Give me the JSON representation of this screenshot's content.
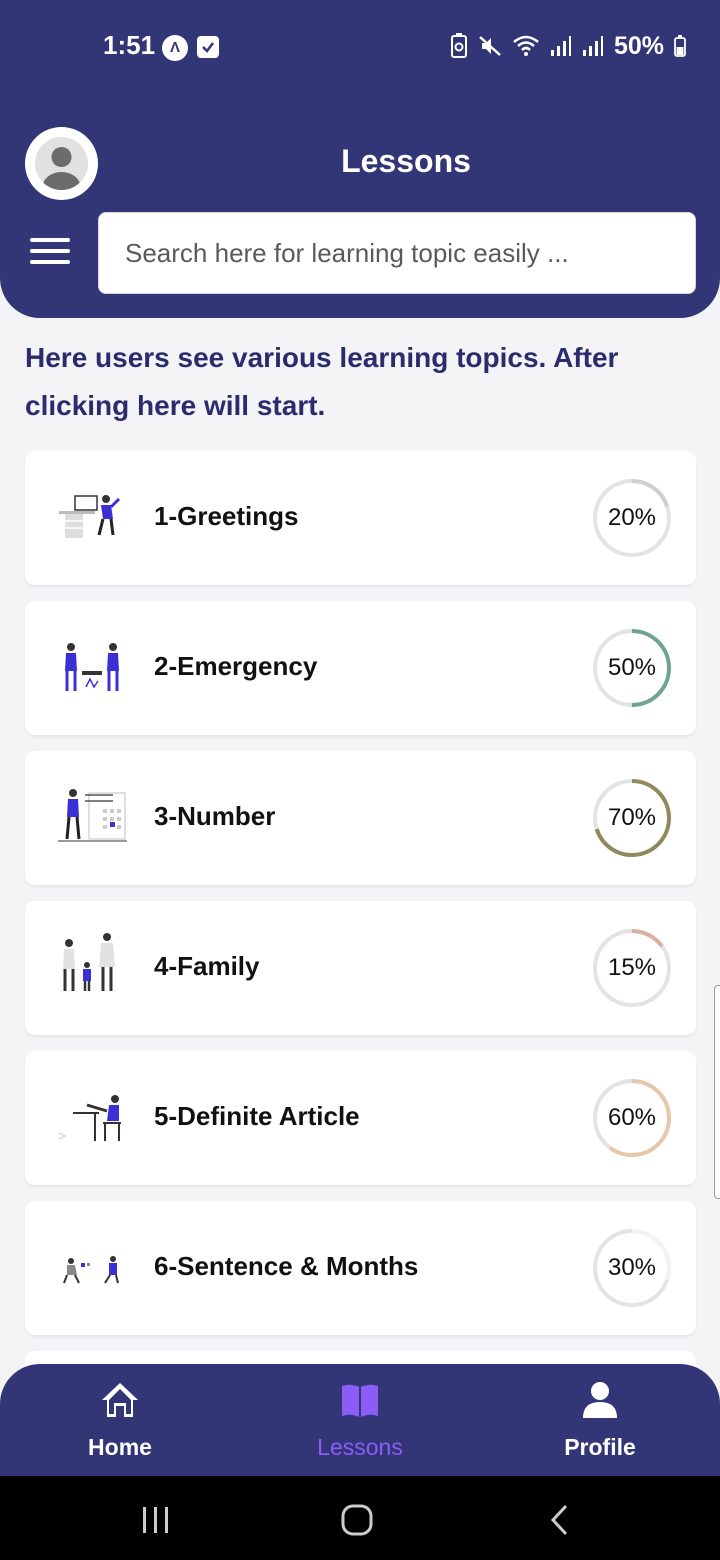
{
  "status_bar": {
    "time": "1:51",
    "battery": "50%"
  },
  "header": {
    "title": "Lessons",
    "search": {
      "placeholder": "Search here for learning topic easily ...",
      "value": ""
    }
  },
  "intro_text": "Here users see various learning topics. After clicking here will start.",
  "lessons": [
    {
      "title": "1-Greetings",
      "progress": "20%",
      "progress_value": 20,
      "color": "#cfcfcf"
    },
    {
      "title": "2-Emergency",
      "progress": "50%",
      "progress_value": 50,
      "color": "#6fa58e"
    },
    {
      "title": "3-Number",
      "progress": "70%",
      "progress_value": 70,
      "color": "#8e8a5c"
    },
    {
      "title": "4-Family",
      "progress": "15%",
      "progress_value": 15,
      "color": "#d9b29e"
    },
    {
      "title": "5-Definite Article",
      "progress": "60%",
      "progress_value": 60,
      "color": "#e6c7a9"
    },
    {
      "title": "6-Sentence & Months",
      "progress": "30%",
      "progress_value": 30,
      "color": "#f3f3f6"
    }
  ],
  "bottom_nav": {
    "items": [
      {
        "label": "Home",
        "icon": "home-icon",
        "active": false
      },
      {
        "label": "Lessons",
        "icon": "book-icon",
        "active": true
      },
      {
        "label": "Profile",
        "icon": "user-icon",
        "active": false
      }
    ]
  },
  "colors": {
    "primary": "#333676",
    "accent": "#8b5cf6",
    "heading": "#2a2c6e"
  }
}
